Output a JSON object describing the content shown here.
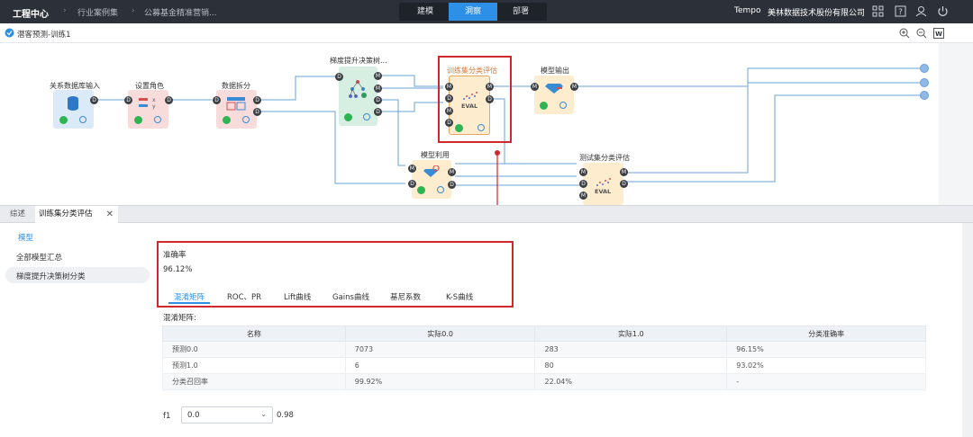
{
  "topbar": {
    "brand": "工程中心",
    "crumbs": [
      "行业案例集",
      "公募基金精准营销..."
    ],
    "modes": [
      "建模",
      "洞察",
      "部署"
    ],
    "active_mode": 1,
    "product": "Tempo",
    "company": "美林数据技术股份有限公司"
  },
  "subbar": {
    "title": "潜客预测-训练1"
  },
  "canvas": {
    "nodes": [
      {
        "label": "关系数据库输入"
      },
      {
        "label": "设置角色"
      },
      {
        "label": "数据拆分"
      },
      {
        "label": "梯度提升决策树..."
      },
      {
        "label": "训练集分类评估"
      },
      {
        "label": "模型输出"
      },
      {
        "label": "模型利用"
      },
      {
        "label": "测试集分类评估"
      }
    ],
    "eval_text": "EVAL"
  },
  "lower_tabs": [
    "综述",
    "训练集分类评估"
  ],
  "sidebar": {
    "section": "模型",
    "items": [
      "全部模型汇总",
      "梯度提升决策树分类"
    ]
  },
  "metrics": {
    "label": "准确率",
    "value": "96.12%",
    "subtabs": [
      "混淆矩阵",
      "ROC、PR",
      "Lift曲线",
      "Gains曲线",
      "基尼系数",
      "K-S曲线"
    ],
    "active_subtab": 0
  },
  "confusion": {
    "caption": "混淆矩阵:",
    "headers": [
      "名称",
      "实际0.0",
      "实际1.0",
      "分类准确率"
    ],
    "rows": [
      [
        "预测0.0",
        "7073",
        "283",
        "96.15%"
      ],
      [
        "预测1.0",
        "6",
        "80",
        "93.02%"
      ],
      [
        "分类召回率",
        "99.92%",
        "22.04%",
        "-"
      ]
    ]
  },
  "f1": {
    "label": "f1",
    "selected": "0.0",
    "value": "0.98"
  },
  "colors": {
    "accent": "#2e8fe6",
    "highlight": "#d0282b",
    "topbar": "#2c3038"
  }
}
